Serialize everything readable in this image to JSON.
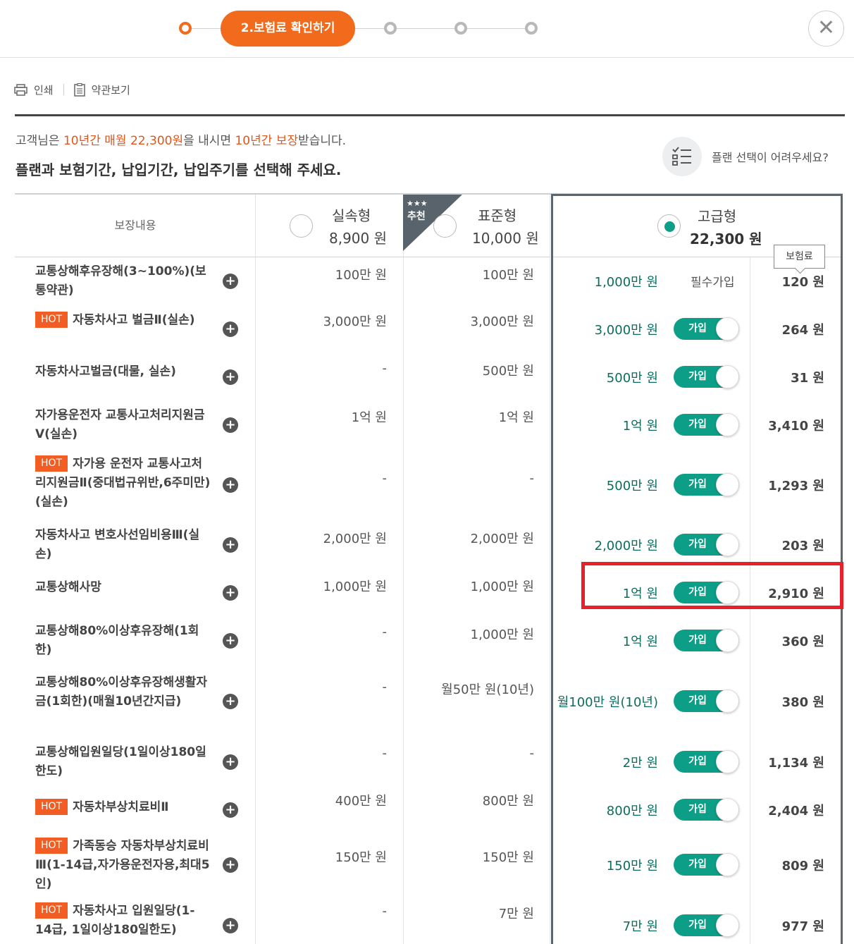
{
  "stepper": {
    "current_label": "2.보험료 확인하기"
  },
  "tools": {
    "print_label": "인쇄",
    "terms_label": "약관보기"
  },
  "summary": {
    "p1": "고객님은 ",
    "h1": "10년간",
    "p2": " ",
    "h2": "매월 22,300원",
    "p3": "을 내시면 ",
    "h3": "10년간 보장",
    "p4": "받습니다.",
    "instruction": "플랜과 보험기간, 납입기간, 납입주기를 선택해 주세요."
  },
  "help": {
    "label": "플랜 선택이 어려우세요?"
  },
  "table": {
    "coverage_header": "보장내용",
    "premium_tooltip": "보험료",
    "recommend_label": "추천",
    "recommend_stars": "★★★",
    "plans": [
      {
        "name": "실속형",
        "price": "8,900 원",
        "selected": false
      },
      {
        "name": "표준형",
        "price": "10,000 원",
        "selected": false
      },
      {
        "name": "고급형",
        "price": "22,300 원",
        "selected": true
      }
    ],
    "toggle_label": "가입",
    "required_label": "필수가입",
    "rows": [
      {
        "hot": false,
        "name": "교통상해후유장해(3~100%)(보통약관)",
        "v1": "100만 원",
        "v2": "100만 원",
        "v3": "1,000만 원",
        "required": true,
        "premium": "120 원"
      },
      {
        "hot": true,
        "name": "자동차사고 벌금Ⅱ(실손)",
        "v1": "3,000만 원",
        "v2": "3,000만 원",
        "v3": "3,000만 원",
        "required": false,
        "premium": "264 원"
      },
      {
        "hot": false,
        "name": "자동차사고벌금(대물, 실손)",
        "v1": "-",
        "v2": "500만 원",
        "v3": "500만 원",
        "required": false,
        "premium": "31 원"
      },
      {
        "hot": false,
        "name": "자가용운전자 교통사고처리지원금Ⅴ(실손)",
        "v1": "1억 원",
        "v2": "1억 원",
        "v3": "1억 원",
        "required": false,
        "premium": "3,410 원"
      },
      {
        "hot": true,
        "name": "자가용 운전자 교통사고처리지원금Ⅱ(중대법규위반,6주미만)(실손)",
        "v1": "-",
        "v2": "-",
        "v3": "500만 원",
        "required": false,
        "premium": "1,293 원"
      },
      {
        "hot": false,
        "name": "자동차사고 변호사선임비용Ⅲ(실손)",
        "v1": "2,000만 원",
        "v2": "2,000만 원",
        "v3": "2,000만 원",
        "required": false,
        "premium": "203 원"
      },
      {
        "hot": false,
        "name": "교통상해사망",
        "v1": "1,000만 원",
        "v2": "1,000만 원",
        "v3": "1억 원",
        "required": false,
        "premium": "2,910 원"
      },
      {
        "hot": false,
        "name": "교통상해80%이상후유장해(1회한)",
        "v1": "-",
        "v2": "1,000만 원",
        "v3": "1억 원",
        "required": false,
        "premium": "360 원"
      },
      {
        "hot": false,
        "name": "교통상해80%이상후유장해생활자금(1회한)(매월10년간지급)",
        "v1": "-",
        "v2": "월50만 원(10년)",
        "v3": "월100만 원(10년)",
        "required": false,
        "premium": "380 원"
      },
      {
        "hot": false,
        "name": "교통상해입원일당(1일이상180일한도)",
        "v1": "-",
        "v2": "-",
        "v3": "2만 원",
        "required": false,
        "premium": "1,134 원"
      },
      {
        "hot": true,
        "name": "자동차부상치료비Ⅱ",
        "v1": "400만 원",
        "v2": "800만 원",
        "v3": "800만 원",
        "required": false,
        "premium": "2,404 원"
      },
      {
        "hot": true,
        "name": "가족동승 자동차부상치료비Ⅲ(1-14급,자가용운전자용,최대5인)",
        "v1": "150만 원",
        "v2": "150만 원",
        "v3": "150만 원",
        "required": false,
        "premium": "809 원"
      },
      {
        "hot": true,
        "name": "자동차사고 입원일당(1-14급, 1일이상180일한도)",
        "v1": "-",
        "v2": "7만 원",
        "v3": "7만 원",
        "required": false,
        "premium": "977 원"
      }
    ]
  },
  "colors": {
    "accent_orange": "#f26a1b",
    "toggle_green": "#0c9e86",
    "value_green": "#0a6e5f",
    "hot_badge": "#f15d22",
    "highlight_red": "#e8202a",
    "selected_border": "#5a6670"
  },
  "icons": [
    "printer-icon",
    "document-icon",
    "checklist-icon",
    "close-icon",
    "plus-icon"
  ]
}
